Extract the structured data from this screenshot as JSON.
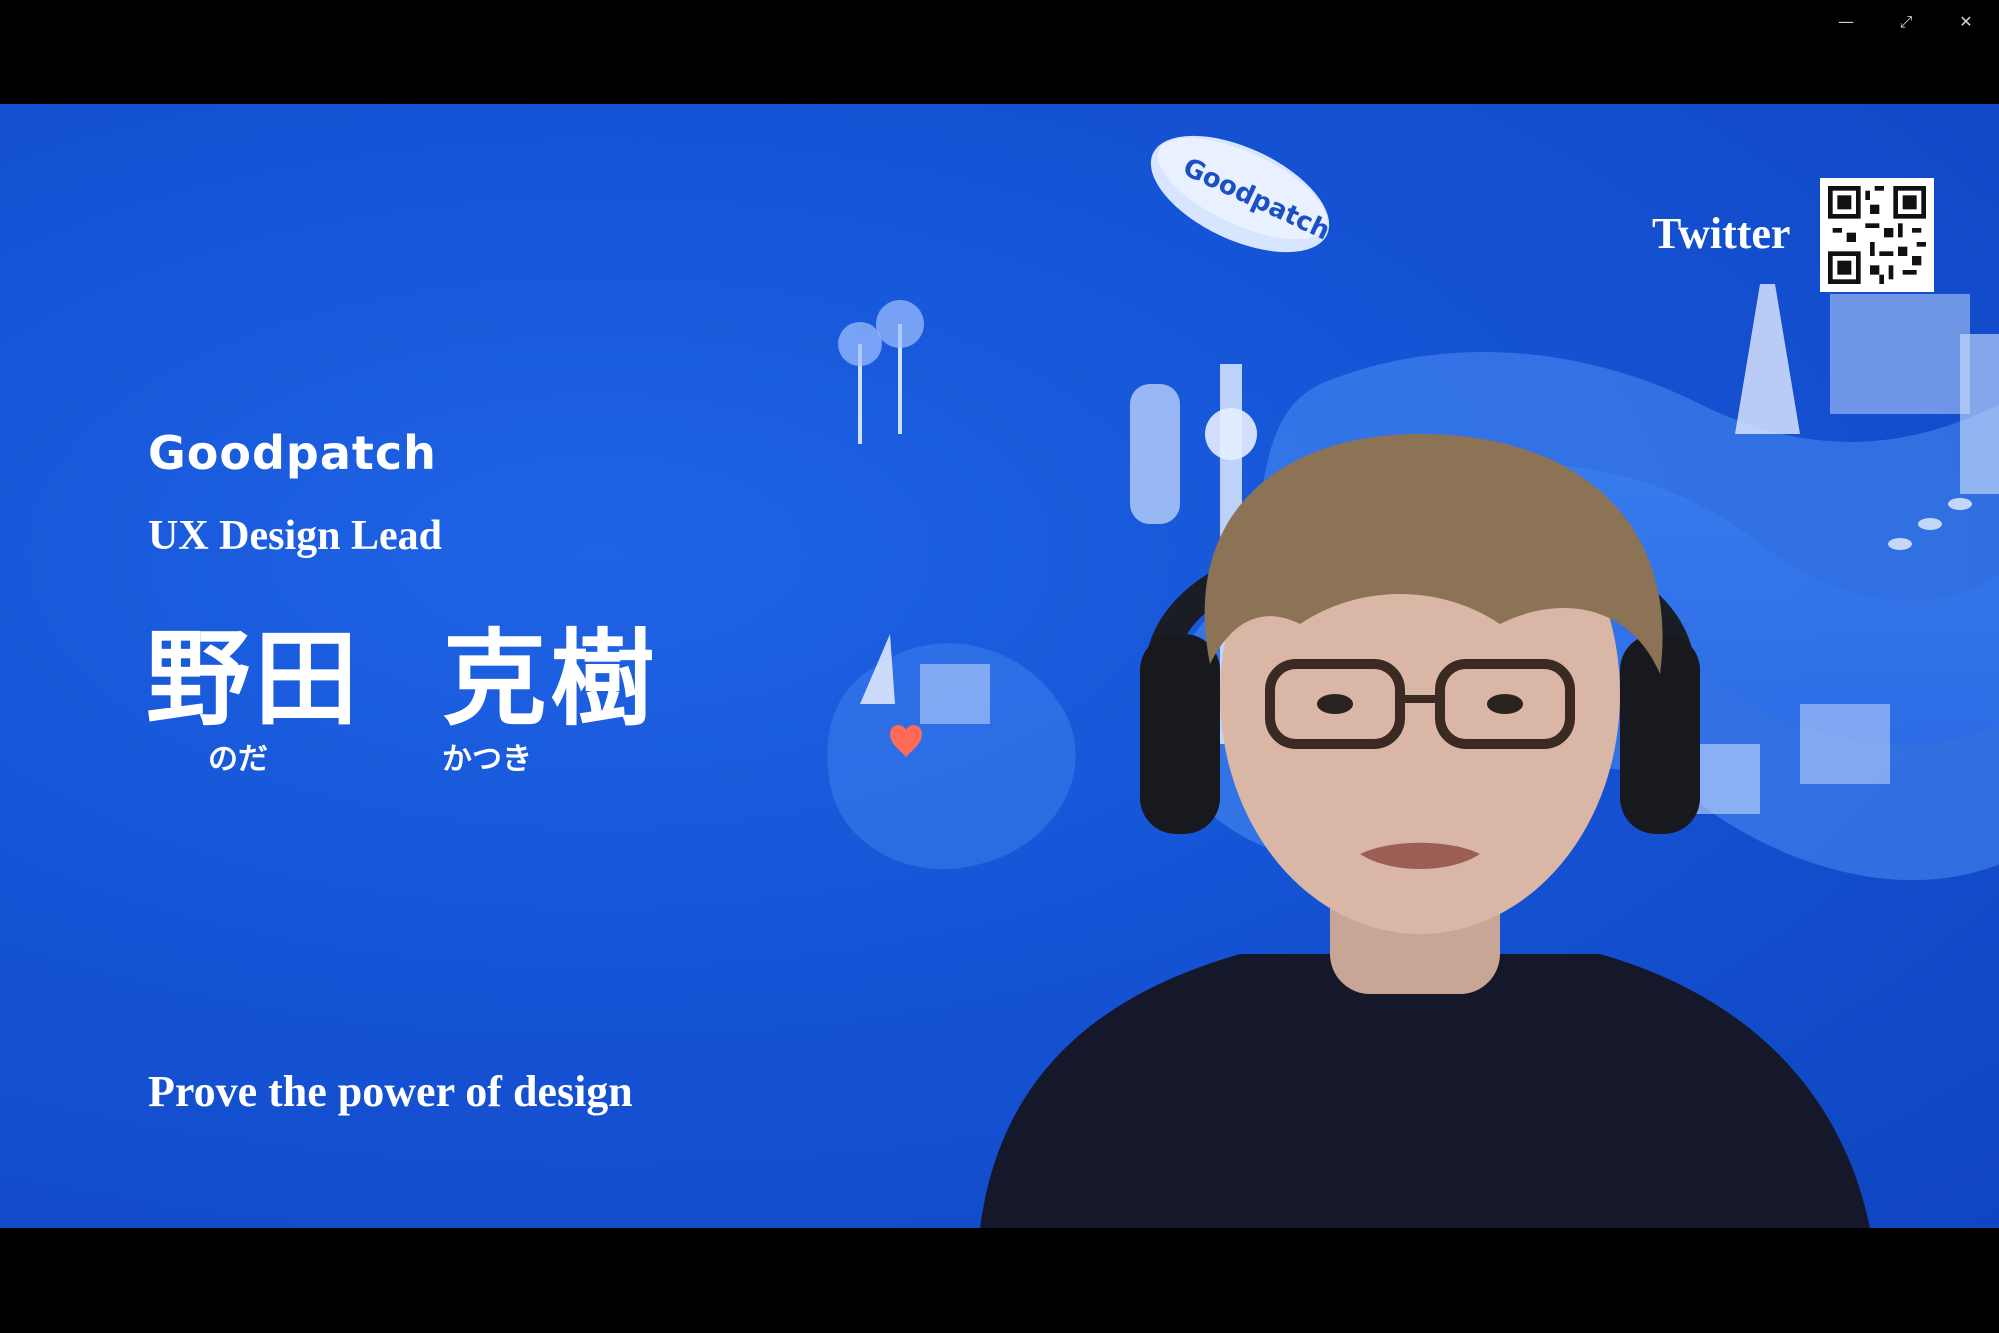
{
  "window": {
    "minimize_icon": "minimize-icon",
    "restore_icon": "restore-icon",
    "close_icon": "close-icon"
  },
  "slide": {
    "logo_text": "Goodpatch",
    "role": "UX Design Lead",
    "name": "野田  克樹",
    "furigana_family": "のだ",
    "furigana_given": "かつき",
    "tagline": "Prove the power of design",
    "twitter_label": "Twitter",
    "blimp_text": "Goodpatch"
  },
  "colors": {
    "background_blue": "#1554d6",
    "text": "#ffffff"
  }
}
